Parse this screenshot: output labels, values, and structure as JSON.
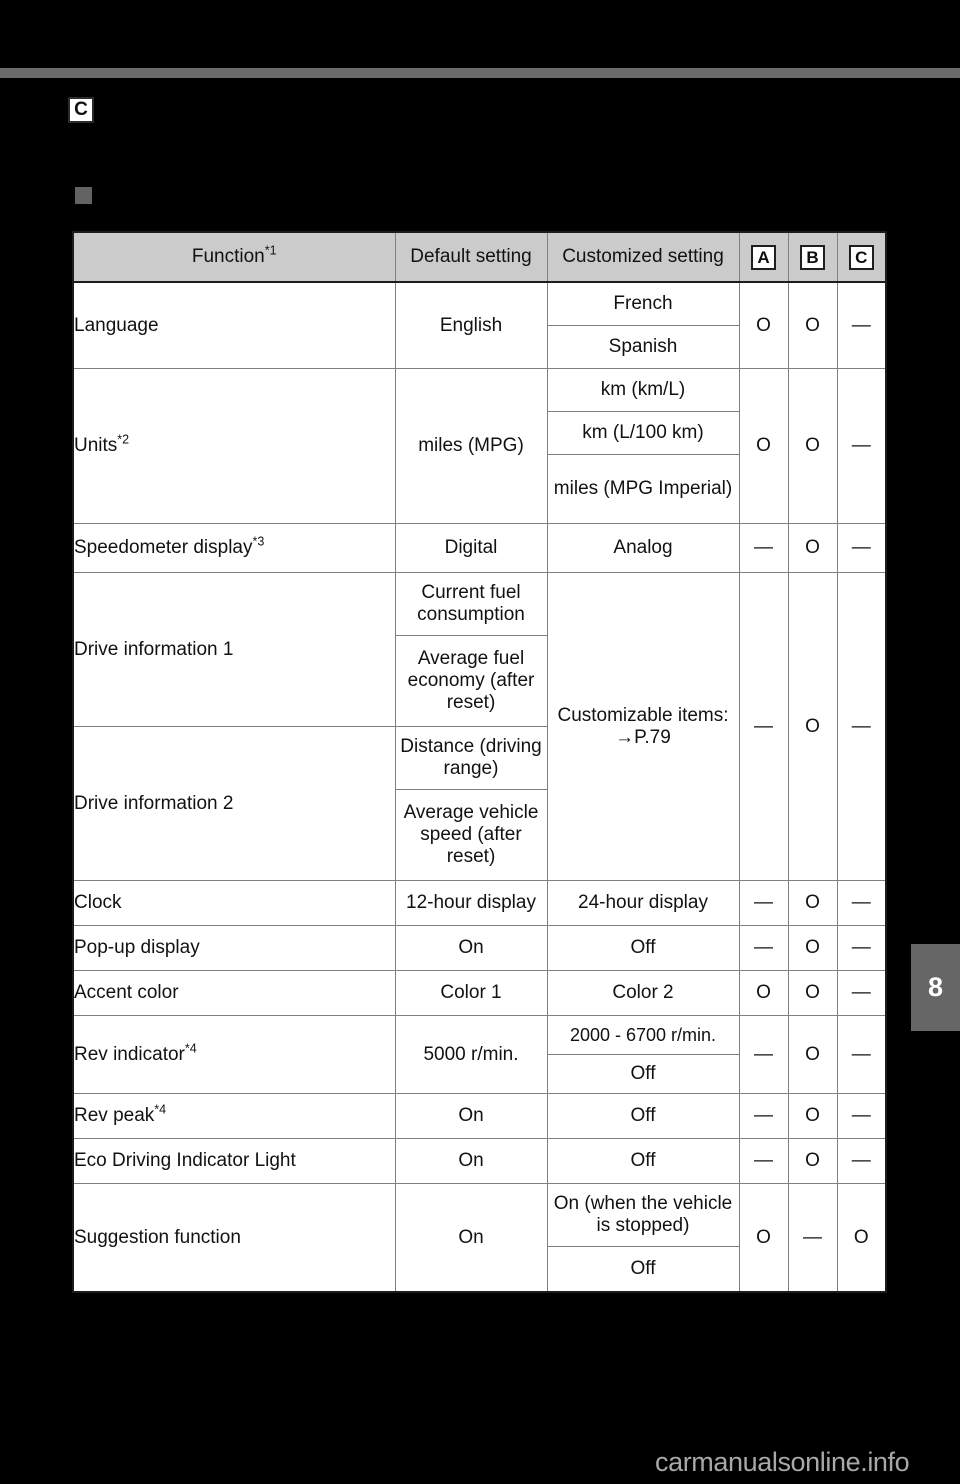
{
  "page": {
    "chapter_tab": "8",
    "watermark": "carmanualsonline.info",
    "badge_c": "C"
  },
  "table": {
    "headers": {
      "function": "Function",
      "function_note": "*1",
      "default_setting": "Default setting",
      "customized_setting": "Customized setting",
      "col_a": "A",
      "col_b": "B",
      "col_c": "C"
    },
    "rows": [
      {
        "function": "Language",
        "function_note": "",
        "default": [
          "English"
        ],
        "customized": [
          "French",
          "Spanish"
        ],
        "a": "O",
        "b": "O",
        "c": "—"
      },
      {
        "function": "Units",
        "function_note": "*2",
        "default": [
          "miles (MPG)"
        ],
        "customized": [
          "km (km/L)",
          "km (L/100 km)",
          "miles (MPG Imperial)"
        ],
        "a": "O",
        "b": "O",
        "c": "—"
      },
      {
        "function": "Speedometer display",
        "function_note": "*3",
        "default": [
          "Digital"
        ],
        "customized": [
          "Analog"
        ],
        "a": "—",
        "b": "O",
        "c": "—"
      },
      {
        "function": "Drive information 1",
        "function_note": "",
        "default": [
          "Current fuel consumption",
          "Average fuel economy (after reset)"
        ],
        "customized": [
          "Customizable items: →P.79"
        ],
        "a": "—",
        "b": "O",
        "c": "—"
      },
      {
        "function": "Drive information 2",
        "function_note": "",
        "default": [
          "Distance (driving range)",
          "Average vehicle speed (after reset)"
        ],
        "customized": [],
        "a": "",
        "b": "",
        "c": ""
      },
      {
        "function": "Clock",
        "function_note": "",
        "default": [
          "12-hour display"
        ],
        "customized": [
          "24-hour display"
        ],
        "a": "—",
        "b": "O",
        "c": "—"
      },
      {
        "function": "Pop-up display",
        "function_note": "",
        "default": [
          "On"
        ],
        "customized": [
          "Off"
        ],
        "a": "—",
        "b": "O",
        "c": "—"
      },
      {
        "function": "Accent color",
        "function_note": "",
        "default": [
          "Color 1"
        ],
        "customized": [
          "Color 2"
        ],
        "a": "O",
        "b": "O",
        "c": "—"
      },
      {
        "function": "Rev indicator",
        "function_note": "*4",
        "default": [
          "5000 r/min."
        ],
        "customized": [
          "2000 - 6700 r/min.",
          "Off"
        ],
        "a": "—",
        "b": "O",
        "c": "—"
      },
      {
        "function": "Rev peak",
        "function_note": "*4",
        "default": [
          "On"
        ],
        "customized": [
          "Off"
        ],
        "a": "—",
        "b": "O",
        "c": "—"
      },
      {
        "function": "Eco Driving Indicator Light",
        "function_note": "",
        "default": [
          "On"
        ],
        "customized": [
          "Off"
        ],
        "a": "—",
        "b": "O",
        "c": "—"
      },
      {
        "function": "Suggestion function",
        "function_note": "",
        "default": [
          "On"
        ],
        "customized": [
          "On (when the vehicle is stopped)",
          "Off"
        ],
        "a": "O",
        "b": "—",
        "c": "O"
      }
    ]
  },
  "cells": {
    "language_fn": "Language",
    "language_def": "English",
    "language_c1": "French",
    "language_c2": "Spanish",
    "language_a": "O",
    "language_b": "O",
    "language_c": "—",
    "units_fn": "Units",
    "units_note": "*2",
    "units_def": "miles (MPG)",
    "units_c1": "km (km/L)",
    "units_c2": "km (L/100 km)",
    "units_c3": "miles (MPG Imperial)",
    "units_a": "O",
    "units_b": "O",
    "units_c": "—",
    "speedo_fn": "Speedometer display",
    "speedo_note": "*3",
    "speedo_def": "Digital",
    "speedo_cust": "Analog",
    "speedo_a": "—",
    "speedo_b": "O",
    "speedo_c": "—",
    "drive1_fn": "Drive information 1",
    "drive1_def1": "Current fuel consumption",
    "drive1_def2": "Average fuel economy (after reset)",
    "drive2_fn": "Drive information 2",
    "drive2_def1": "Distance (driving range)",
    "drive2_def2": "Average vehicle speed (after reset)",
    "drive_cust_line1": "Customizable items:",
    "drive_cust_line2": "→P.79",
    "drive_a": "—",
    "drive_b": "O",
    "drive_c": "—",
    "clock_fn": "Clock",
    "clock_def": "12-hour display",
    "clock_cust": "24-hour display",
    "clock_a": "—",
    "clock_b": "O",
    "clock_c": "—",
    "popup_fn": "Pop-up display",
    "popup_def": "On",
    "popup_cust": "Off",
    "popup_a": "—",
    "popup_b": "O",
    "popup_c": "—",
    "accent_fn": "Accent color",
    "accent_def": "Color 1",
    "accent_cust": "Color 2",
    "accent_a": "O",
    "accent_b": "O",
    "accent_c": "—",
    "revind_fn": "Rev indicator",
    "revind_note": "*4",
    "revind_def": "5000 r/min.",
    "revind_c1": "2000 - 6700 r/min.",
    "revind_c2": "Off",
    "revind_a": "—",
    "revind_b": "O",
    "revind_c": "—",
    "revpeak_fn": "Rev peak",
    "revpeak_note": "*4",
    "revpeak_def": "On",
    "revpeak_cust": "Off",
    "revpeak_a": "—",
    "revpeak_b": "O",
    "revpeak_c": "—",
    "eco_fn": "Eco Driving Indicator Light",
    "eco_def": "On",
    "eco_cust": "Off",
    "eco_a": "—",
    "eco_b": "O",
    "eco_c": "—",
    "sugg_fn": "Suggestion function",
    "sugg_def": "On",
    "sugg_c1": "On (when the vehicle is stopped)",
    "sugg_c2": "Off",
    "sugg_a": "O",
    "sugg_b": "—",
    "sugg_c": "O"
  }
}
